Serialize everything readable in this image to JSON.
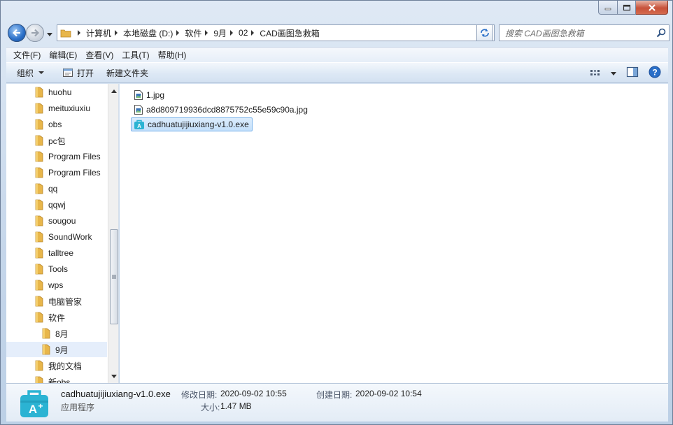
{
  "window": {
    "caption_buttons": [
      "minimize-icon",
      "maximize-icon",
      "close-icon"
    ]
  },
  "navigation": {
    "breadcrumb": [
      "计算机",
      "本地磁盘 (D:)",
      "软件",
      "9月",
      "02",
      "CAD画图急救箱"
    ],
    "search_placeholder": "搜索 CAD画图急救箱"
  },
  "menu": [
    "文件(F)",
    "编辑(E)",
    "查看(V)",
    "工具(T)",
    "帮助(H)"
  ],
  "toolbar": {
    "organize": "组织",
    "open": "打开",
    "new_folder": "新建文件夹"
  },
  "nav_tree": [
    {
      "label": "huohu"
    },
    {
      "label": "meituxiuxiu"
    },
    {
      "label": "obs"
    },
    {
      "label": "pc包"
    },
    {
      "label": "Program Files"
    },
    {
      "label": "Program Files"
    },
    {
      "label": "qq"
    },
    {
      "label": "qqwj"
    },
    {
      "label": "sougou"
    },
    {
      "label": "SoundWork"
    },
    {
      "label": "talltree"
    },
    {
      "label": "Tools"
    },
    {
      "label": "wps"
    },
    {
      "label": "电脑管家"
    },
    {
      "label": "软件"
    },
    {
      "label": "8月"
    },
    {
      "label": "9月"
    },
    {
      "label": "我的文档"
    },
    {
      "label": "新obs"
    }
  ],
  "files": [
    {
      "name": "1.jpg",
      "icon": "image-file-icon"
    },
    {
      "name": "a8d809719936dcd8875752c55e59c90a.jpg",
      "icon": "image-file-icon"
    },
    {
      "name": "cadhuatujijiuxiang-v1.0.exe",
      "icon": "app-exe-icon"
    }
  ],
  "details": {
    "name": "cadhuatujijiuxiang-v1.0.exe",
    "type": "应用程序",
    "modified_label": "修改日期:",
    "modified": "2020-09-02 10:55",
    "created_label": "创建日期:",
    "created": "2020-09-02 10:54",
    "size_label": "大小:",
    "size": "1.47 MB"
  },
  "colors": {
    "accent": "#2a6fc8",
    "selection": "#c4e0fb",
    "folder": "#e8b64a",
    "app_icon": "#2bb3d3"
  }
}
